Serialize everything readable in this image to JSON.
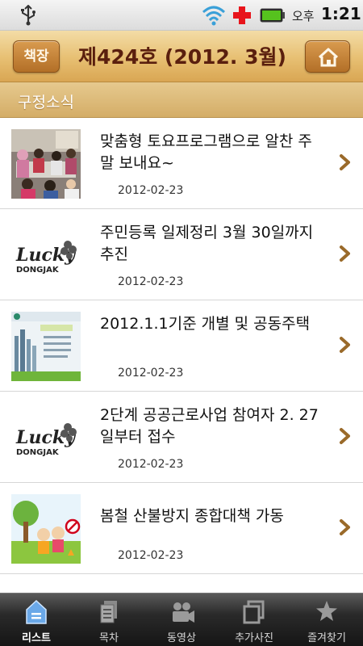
{
  "status_bar": {
    "ampm": "오후",
    "time": "1:21"
  },
  "header": {
    "left_button_label": "책장",
    "issue_title": "제424호 (2012. 3월)"
  },
  "section": {
    "title": "구정소식"
  },
  "list": {
    "items": [
      {
        "title": "맞춤형 토요프로그램으로 알찬 주말 보내요~",
        "date": "2012-02-23",
        "thumb": "classroom-photo"
      },
      {
        "title": "주민등록 일제정리 3월 30일까지 추진",
        "date": "2012-02-23",
        "thumb": "lucky-dongjak-logo"
      },
      {
        "title": "2012.1.1기준 개별 및 공동주택",
        "date": "2012-02-23",
        "thumb": "document-cover"
      },
      {
        "title": "2단계 공공근로사업 참여자 2. 27일부터 접수",
        "date": "2012-02-23",
        "thumb": "lucky-dongjak-logo"
      },
      {
        "title": "봄철 산불방지 종합대책 가동",
        "date": "2012-02-23",
        "thumb": "forest-fire-illustration"
      }
    ],
    "logo_word": "Lucky",
    "logo_sub": "DONGJAK"
  },
  "tabbar": {
    "tabs": [
      {
        "label": "리스트",
        "icon": "home-list-icon",
        "active": true
      },
      {
        "label": "목차",
        "icon": "document-icon",
        "active": false
      },
      {
        "label": "동영상",
        "icon": "video-camera-icon",
        "active": false
      },
      {
        "label": "추가사진",
        "icon": "photos-icon",
        "active": false
      },
      {
        "label": "즐겨찾기",
        "icon": "star-icon",
        "active": false
      }
    ]
  },
  "colors": {
    "title_text": "#5a1f0e",
    "header_wood": "#e7bf72",
    "chevron": "#9a6a2a",
    "active_tab_icon": "#6aa8e8"
  }
}
